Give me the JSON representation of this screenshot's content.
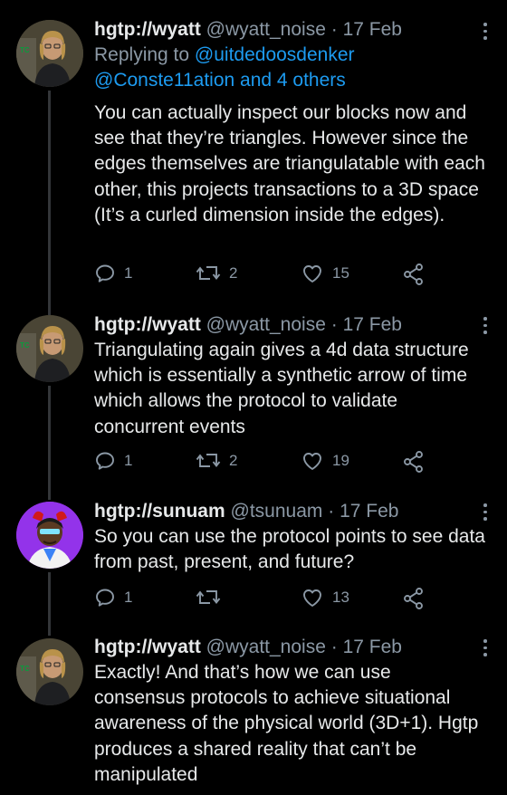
{
  "tweets": [
    {
      "name": "hgtp://wyatt",
      "handle": "@wyatt_noise",
      "sep": "·",
      "date": "17 Feb",
      "reply_label": "Replying to ",
      "reply_link1": "@uitdedoosdenker",
      "reply_link2": "@Conste11ation and 4 others",
      "text": "You can actually inspect our blocks now and see that they’re triangles. However since the edges themselves are triangulatable with each other, this projects transactions to a 3D space (It’s a curled dimension inside the edges).",
      "replies": "1",
      "retweets": "2",
      "likes": "15"
    },
    {
      "name": "hgtp://wyatt",
      "handle": "@wyatt_noise",
      "sep": "·",
      "date": "17 Feb",
      "text": "Triangulating again gives a 4d data structure which is essentially a synthetic arrow of time which allows the protocol to validate concurrent events",
      "replies": "1",
      "retweets": "2",
      "likes": "19"
    },
    {
      "name": "hgtp://sunuam",
      "handle": "@tsunuam",
      "sep": "·",
      "date": "17 Feb",
      "text": "So you can use the protocol points to see data from past, present, and future?",
      "replies": "1",
      "retweets": "",
      "likes": "13"
    },
    {
      "name": "hgtp://wyatt",
      "handle": "@wyatt_noise",
      "sep": "·",
      "date": "17 Feb",
      "text": "Exactly! And that’s how we can use consensus protocols to achieve situational awareness of the physical world (3D+1). Hgtp produces a shared reality that can’t be manipulated"
    }
  ],
  "avatar_logo_text": "TC"
}
